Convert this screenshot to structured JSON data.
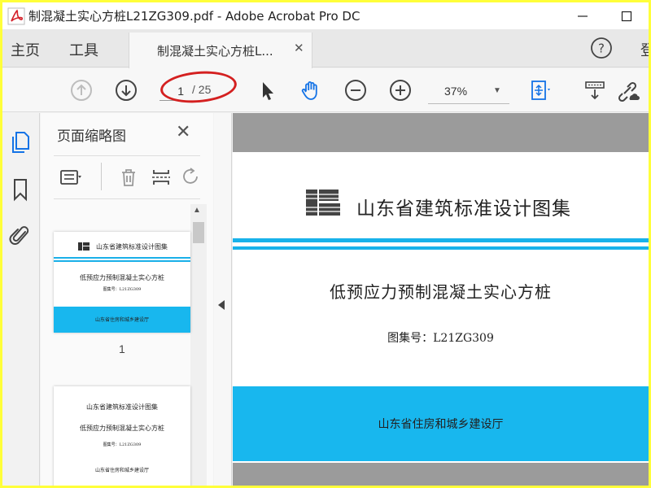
{
  "window": {
    "title": "制混凝土实心方桩L21ZG309.pdf - Adobe Acrobat Pro DC"
  },
  "menu": {
    "home": "主页",
    "tools": "工具",
    "doc_tab": "制混凝土实心方桩L...",
    "signin": "登"
  },
  "toolbar": {
    "current_page": "1",
    "total_pages": "/ 25",
    "zoom": "37%"
  },
  "thumbnails_panel": {
    "title": "页面缩略图",
    "thumbs": [
      {
        "header": "山东省建筑标准设计图集",
        "title": "低预应力预制混凝土实心方桩",
        "number": "图集号：L21ZG309",
        "publisher": "山东省住房和城乡建设厅",
        "page_label": "1"
      },
      {
        "header": "山东省建筑标准设计图集",
        "title": "低预应力预制混凝土实心方桩",
        "number": "图集号：L21ZG309",
        "publisher": "山东省住房和城乡建设厅"
      }
    ]
  },
  "document": {
    "header": "山东省建筑标准设计图集",
    "title": "低预应力预制混凝土实心方桩",
    "number": "图集号：L21ZG309",
    "publisher": "山东省住房和城乡建设厅"
  },
  "colors": {
    "accent_blue": "#18b7ee",
    "annotation_red": "#d42020",
    "frame_yellow": "#ffff3a"
  },
  "icons": [
    "acrobat-logo-icon",
    "minimize-icon",
    "maximize-icon",
    "close-icon",
    "help-icon",
    "prev-page-icon",
    "next-page-icon",
    "select-cursor-icon",
    "hand-tool-icon",
    "zoom-out-icon",
    "zoom-in-icon",
    "fit-page-icon",
    "scroll-mode-icon",
    "share-link-icon",
    "thumbnails-icon",
    "bookmark-icon",
    "attachment-icon",
    "page-options-icon",
    "delete-icon",
    "insert-page-icon",
    "rotate-icon"
  ]
}
